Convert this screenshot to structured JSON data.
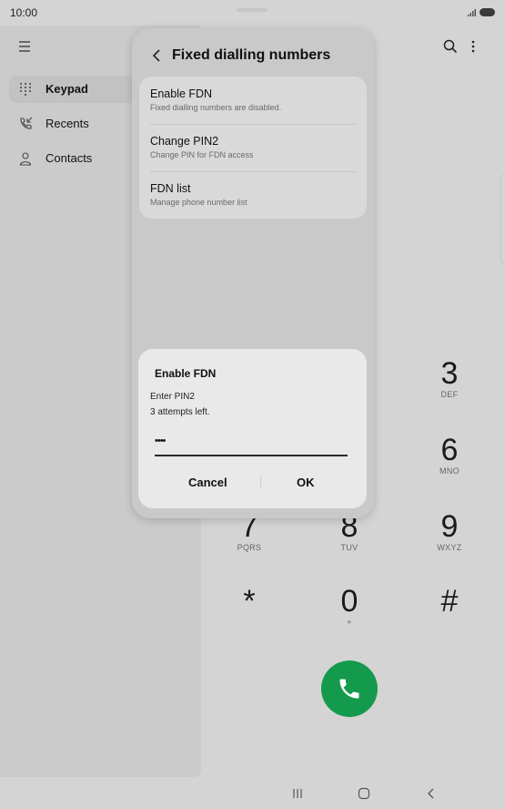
{
  "status": {
    "time": "10:00"
  },
  "sidebar": {
    "items": [
      {
        "label": "Keypad",
        "icon": "keypad-icon",
        "active": true
      },
      {
        "label": "Recents",
        "icon": "recents-call-icon",
        "active": false
      },
      {
        "label": "Contacts",
        "icon": "contacts-person-icon",
        "active": false
      }
    ]
  },
  "keypad": {
    "keys": [
      {
        "digit": "3",
        "letters": "DEF"
      },
      {
        "digit": "6",
        "letters": "MNO"
      },
      {
        "digit": "7",
        "letters": "PQRS"
      },
      {
        "digit": "8",
        "letters": "TUV"
      },
      {
        "digit": "9",
        "letters": "WXYZ"
      },
      {
        "digit": "*",
        "letters": ""
      },
      {
        "digit": "0",
        "letters": "+"
      },
      {
        "digit": "#",
        "letters": ""
      }
    ]
  },
  "fdn_panel": {
    "title": "Fixed dialling numbers",
    "rows": [
      {
        "title": "Enable FDN",
        "subtitle": "Fixed dialling numbers are disabled."
      },
      {
        "title": "Change PIN2",
        "subtitle": "Change PIN for FDN access"
      },
      {
        "title": "FDN list",
        "subtitle": "Manage phone number list"
      }
    ]
  },
  "dialog": {
    "title": "Enable FDN",
    "prompt": "Enter PIN2",
    "attempts": "3 attempts left.",
    "pin_value": "••••",
    "cancel_label": "Cancel",
    "ok_label": "OK"
  },
  "colors": {
    "call_green": "#149a4d",
    "background": "#d4d4d4"
  }
}
